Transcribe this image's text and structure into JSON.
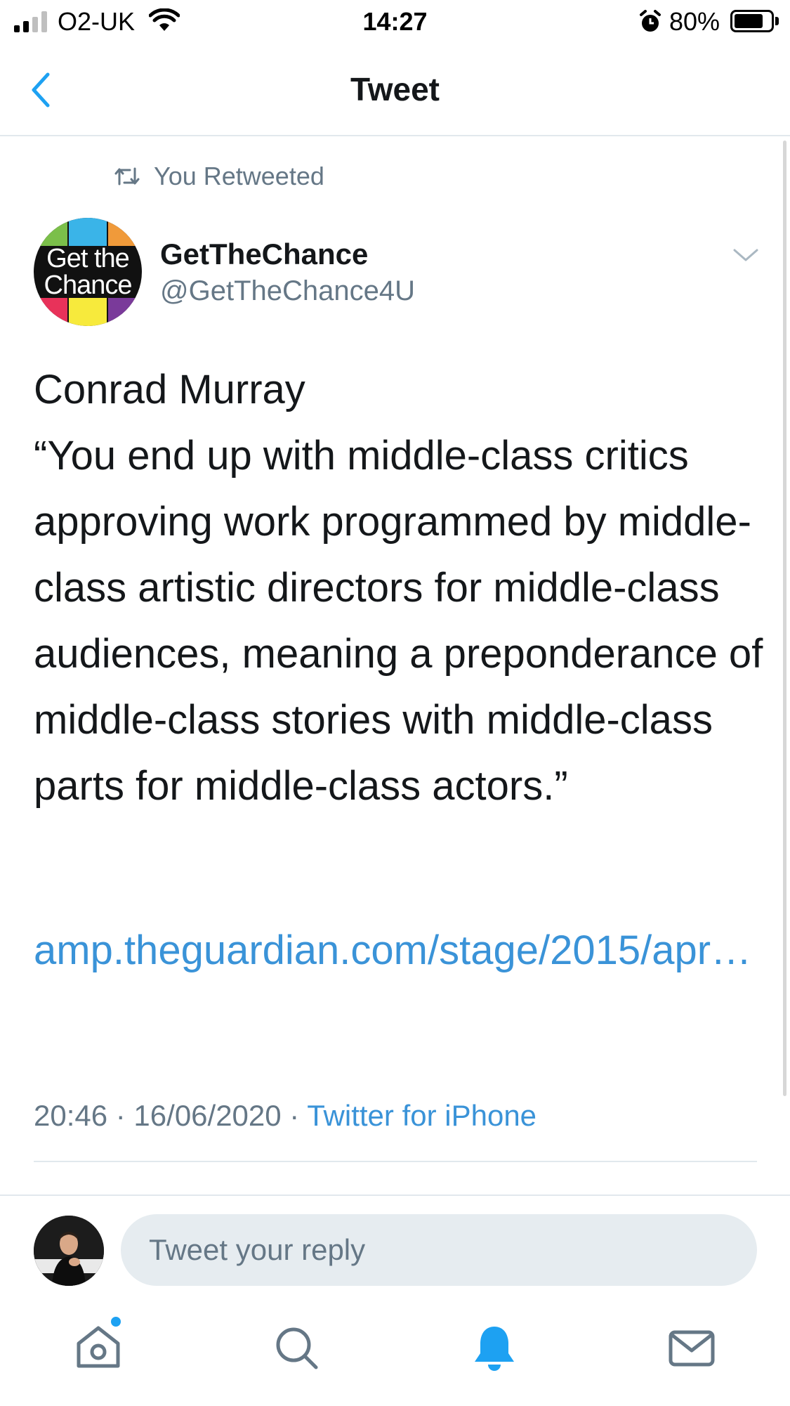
{
  "status_bar": {
    "carrier": "O2-UK",
    "time": "14:27",
    "battery_percent": "80%",
    "battery_level": 0.8,
    "signal_bars": 2
  },
  "header": {
    "title": "Tweet",
    "back_icon": "chevron-left-icon"
  },
  "tweet": {
    "social_context": "You Retweeted",
    "author": {
      "display_name": "GetTheChance",
      "handle": "@GetTheChance4U",
      "avatar_text_1": "Get the",
      "avatar_text_2": "Chance"
    },
    "body_lines": [
      "Conrad Murray",
      "“You end up with middle-class critics approving work programmed by middle-class artistic directors for middle-class audiences, meaning a preponderance of middle-class stories with middle-class parts for middle-class actors.”"
    ],
    "link_text": "amp.theguardian.com/stage/2015/apr…",
    "timestamp": "20:46 · 16/06/2020",
    "separator": " · ",
    "source": "Twitter for iPhone"
  },
  "reply": {
    "placeholder": "Tweet your reply"
  },
  "tab_bar": {
    "items": [
      {
        "icon": "home-icon",
        "has_badge": true
      },
      {
        "icon": "search-icon",
        "has_badge": false
      },
      {
        "icon": "bell-icon",
        "active": true
      },
      {
        "icon": "mail-icon",
        "has_badge": false
      }
    ]
  },
  "colors": {
    "accent": "#1da1f2",
    "link": "#3a93d8",
    "secondary_text": "#657786",
    "divider": "#e1e8ed",
    "input_bg": "#e6ecf0"
  }
}
